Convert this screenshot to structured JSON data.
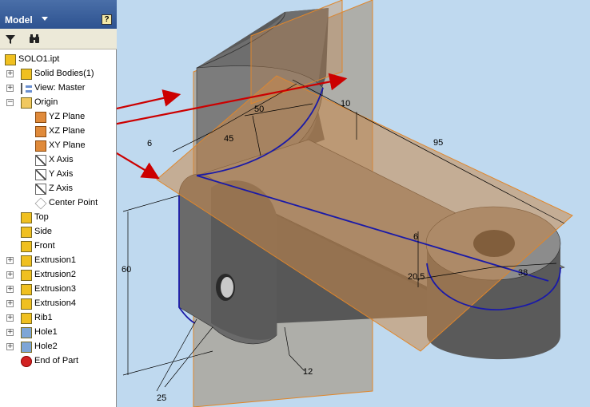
{
  "browser": {
    "title": "Model",
    "help_label": "?",
    "toolbar": {
      "filter_icon": "filter-icon",
      "find_icon": "binoculars-icon"
    },
    "tree": [
      {
        "label": "SOLO1.ipt",
        "icon": "part-icon"
      },
      {
        "label": "Solid Bodies(1)",
        "icon": "solid-bodies-icon"
      },
      {
        "label": "View: Master",
        "icon": "view-icon"
      },
      {
        "label": "Origin",
        "icon": "folder-icon"
      },
      {
        "label": "YZ Plane",
        "icon": "plane-icon"
      },
      {
        "label": "XZ Plane",
        "icon": "plane-icon"
      },
      {
        "label": "XY Plane",
        "icon": "plane-icon"
      },
      {
        "label": "X Axis",
        "icon": "axis-icon"
      },
      {
        "label": "Y Axis",
        "icon": "axis-icon"
      },
      {
        "label": "Z Axis",
        "icon": "axis-icon"
      },
      {
        "label": "Center Point",
        "icon": "point-icon"
      },
      {
        "label": "Top",
        "icon": "sketch-icon"
      },
      {
        "label": "Side",
        "icon": "sketch-icon"
      },
      {
        "label": "Front",
        "icon": "sketch-icon"
      },
      {
        "label": "Extrusion1",
        "icon": "extrusion-icon"
      },
      {
        "label": "Extrusion2",
        "icon": "extrusion-icon"
      },
      {
        "label": "Extrusion3",
        "icon": "extrusion-icon"
      },
      {
        "label": "Extrusion4",
        "icon": "extrusion-icon"
      },
      {
        "label": "Rib1",
        "icon": "rib-icon"
      },
      {
        "label": "Hole1",
        "icon": "hole-icon"
      },
      {
        "label": "Hole2",
        "icon": "hole-icon"
      },
      {
        "label": "End of Part",
        "icon": "end-of-part-icon"
      }
    ]
  },
  "viewport": {
    "dimensions": {
      "d50": "50",
      "d10": "10",
      "d45": "45",
      "d95": "95",
      "d6_left": "6",
      "d6_boss": "6",
      "d60": "60",
      "d20_5": "20,5",
      "d38": "38",
      "d12": "12",
      "d25": "25"
    },
    "colors": {
      "background": "#bfd9ef",
      "plane_fill": "#c8884a",
      "plane_edge": "#e0862a",
      "arrow": "#cc0000",
      "edge_highlight": "#1a1aa8"
    }
  }
}
